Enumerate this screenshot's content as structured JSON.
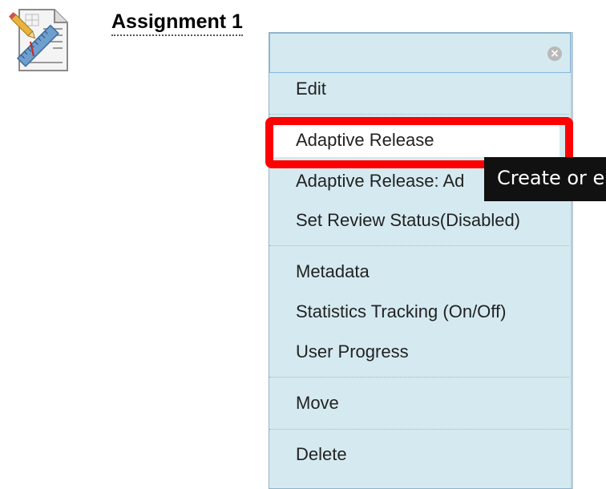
{
  "content_item": {
    "title": "Assignment 1",
    "icon": "assignment-icon"
  },
  "context_menu": {
    "close_icon": "close-circle-icon",
    "groups": [
      {
        "items": [
          {
            "label": "Edit"
          }
        ]
      },
      {
        "items": [
          {
            "label": "Adaptive Release",
            "highlighted": true
          },
          {
            "label": "Adaptive Release: Ad"
          },
          {
            "label": "Set Review Status(Disabled)"
          }
        ]
      },
      {
        "items": [
          {
            "label": "Metadata"
          },
          {
            "label": "Statistics Tracking (On/Off)"
          },
          {
            "label": "User Progress"
          }
        ]
      },
      {
        "items": [
          {
            "label": "Move"
          }
        ]
      },
      {
        "items": [
          {
            "label": "Delete"
          }
        ]
      }
    ]
  },
  "tooltip": {
    "text": "Create or e"
  },
  "colors": {
    "menu_background": "#d5eaf0",
    "highlight": "#ff0000",
    "tooltip_background": "#111111"
  }
}
